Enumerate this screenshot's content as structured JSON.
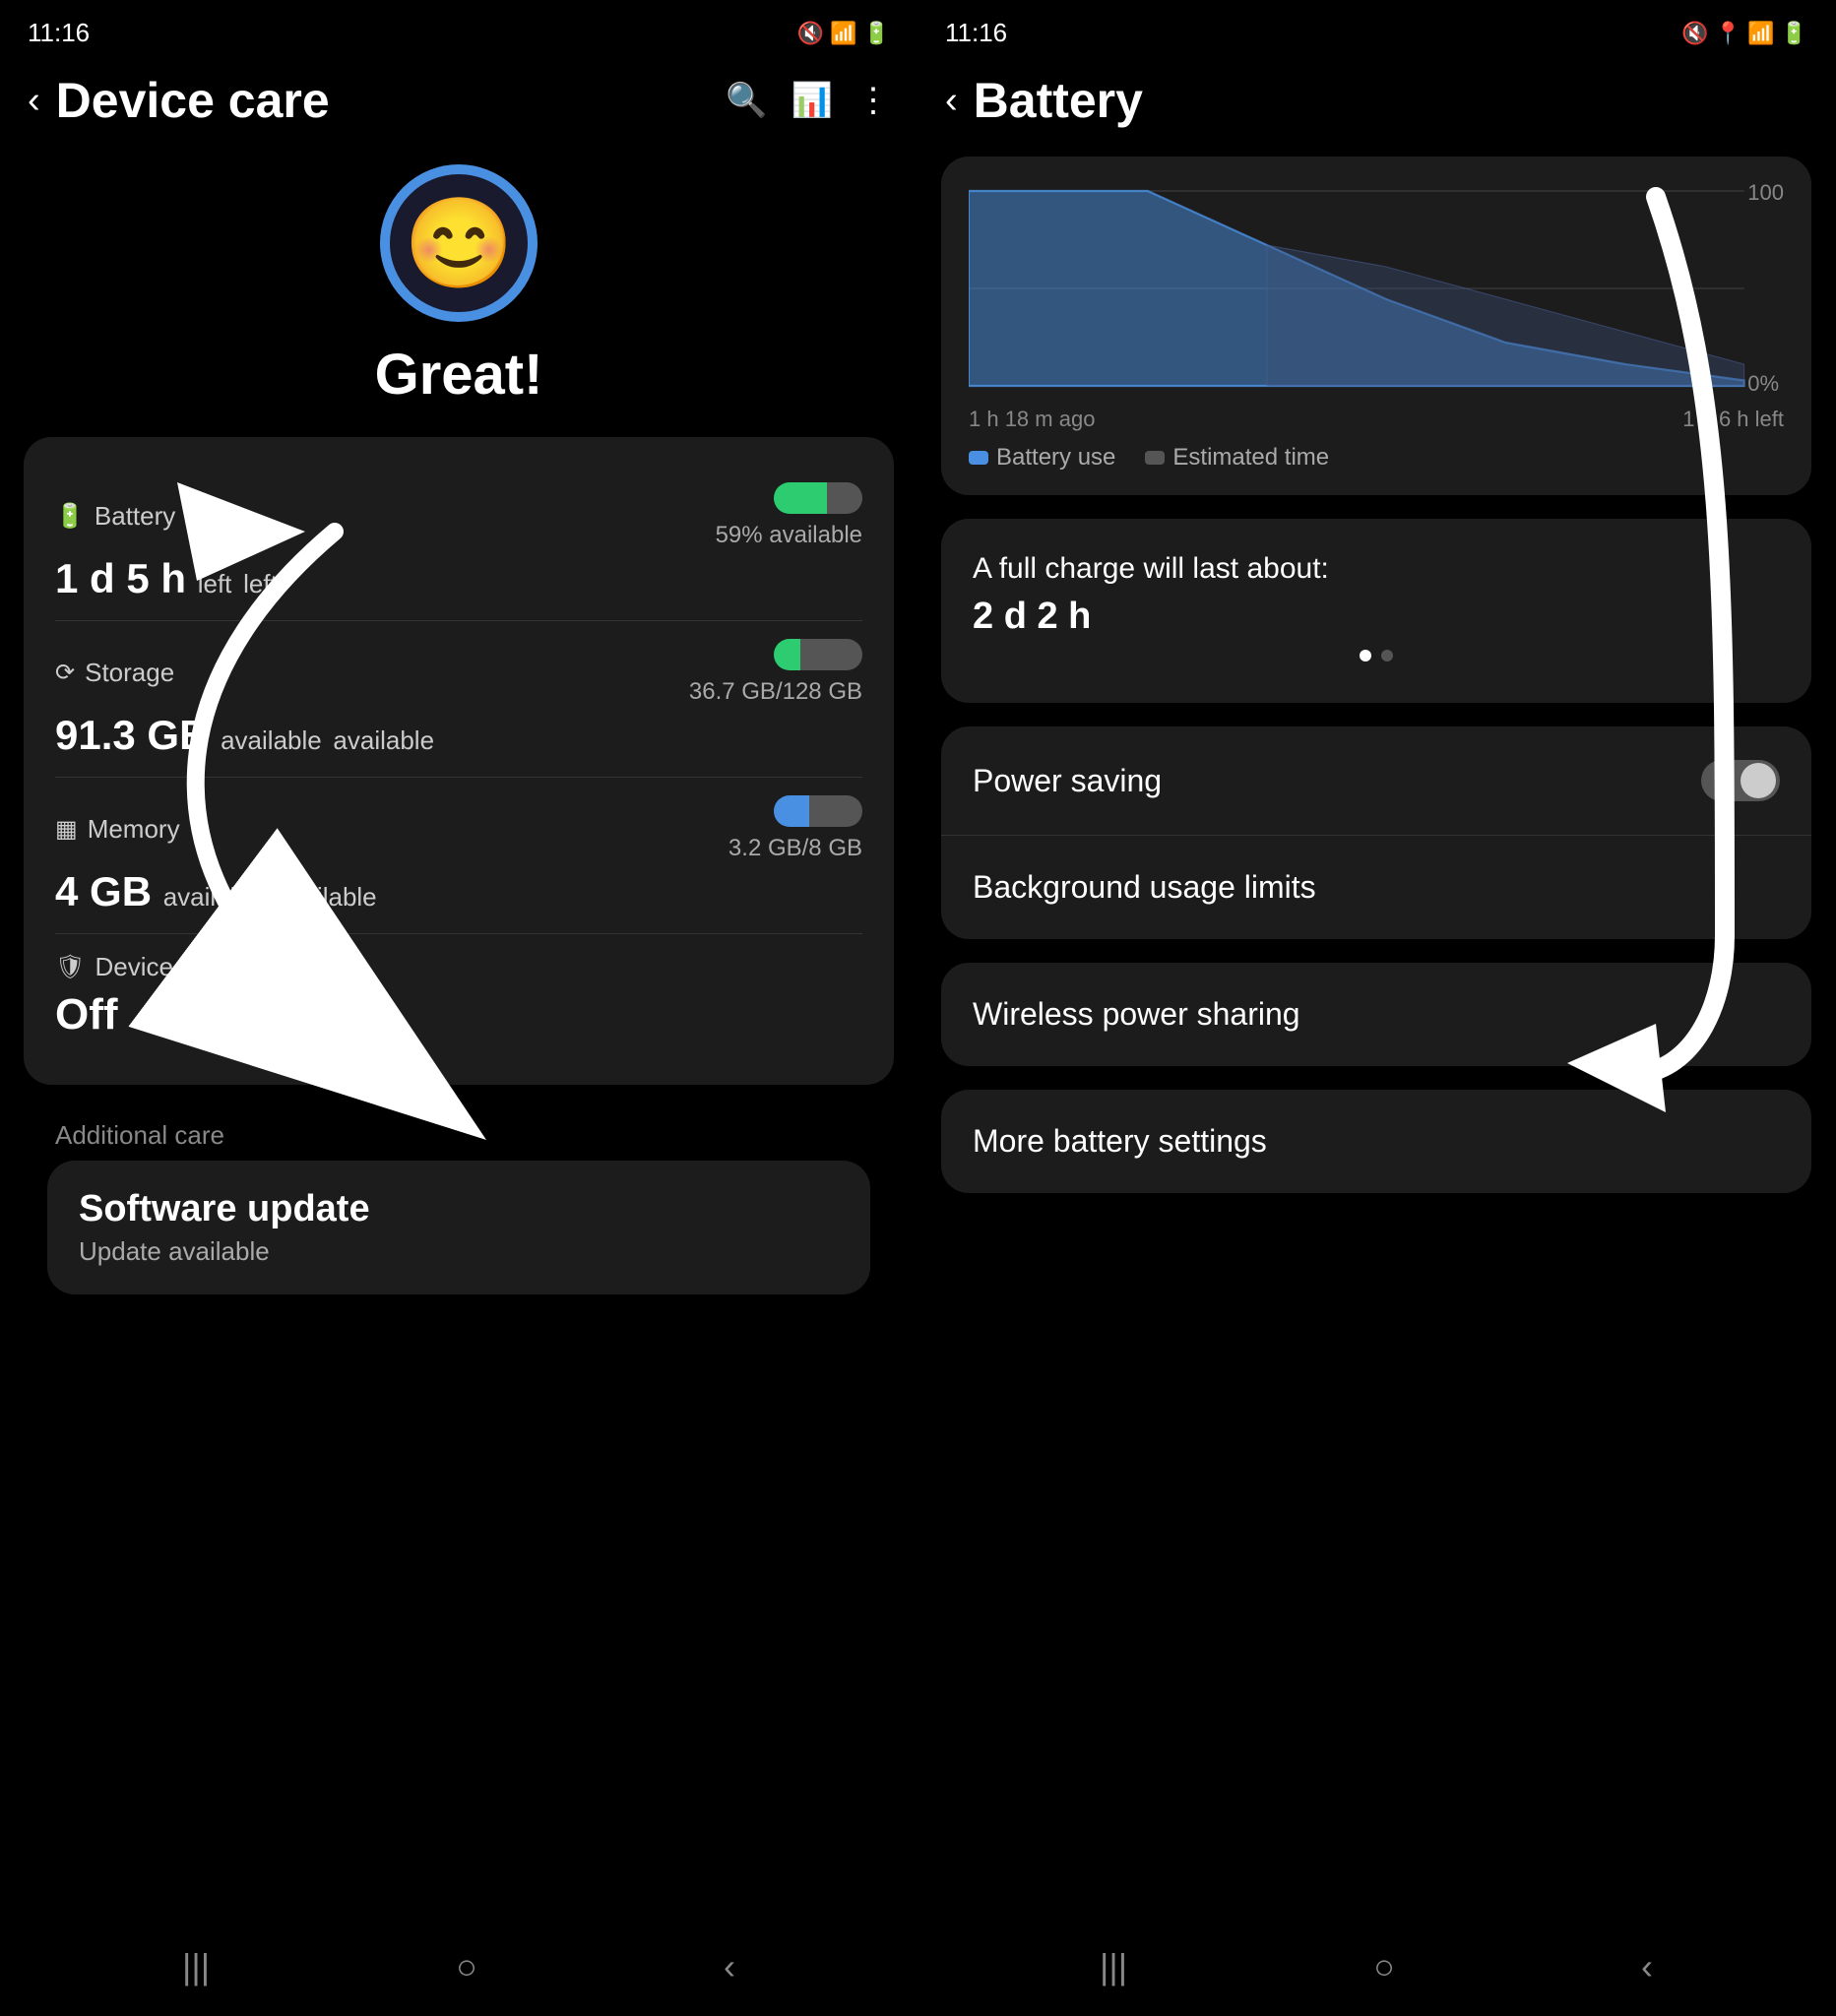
{
  "left": {
    "statusBar": {
      "time": "11:16",
      "rightIcons": "🔇 📶 📶 🔋"
    },
    "topBar": {
      "backLabel": "‹",
      "title": "Device care",
      "searchIcon": "🔍",
      "chartIcon": "📊",
      "moreIcon": "⋮"
    },
    "hero": {
      "statusText": "Great!"
    },
    "battery": {
      "sectionTitle": "Battery",
      "icon": "🔋",
      "value": "1 d 5 h",
      "suffix": "left",
      "available": "59% available"
    },
    "storage": {
      "sectionTitle": "Storage",
      "icon": "⟳",
      "value": "91.3 GB",
      "suffix": "available",
      "used": "36.7 GB",
      "total": "/128 GB"
    },
    "memory": {
      "sectionTitle": "Memory",
      "icon": "▦",
      "value": "4 GB",
      "suffix": "available",
      "used": "3.2 GB",
      "total": "/8 GB"
    },
    "deviceProtection": {
      "sectionTitle": "Device protection",
      "icon": "🛡",
      "value": "Off"
    },
    "additionalCare": {
      "sectionLabel": "Additional care",
      "softwareUpdate": {
        "title": "Software update",
        "subtitle": "Update available"
      }
    },
    "bottomNav": {
      "recents": "|||",
      "home": "○",
      "back": "‹"
    }
  },
  "right": {
    "statusBar": {
      "time": "11:16",
      "rightIcons": "🔇 📍 📶 🔋"
    },
    "topBar": {
      "backLabel": "‹",
      "title": "Battery"
    },
    "chart": {
      "yMax": "100",
      "yMin": "0%",
      "xLeft": "1 h 18 m ago",
      "xRight": "1 d 6 h left",
      "legendBatteryUse": "Battery use",
      "legendEstimatedTime": "Estimated time"
    },
    "fullCharge": {
      "label": "A full charge will last about:",
      "value": "2 d 2 h"
    },
    "powerSaving": {
      "label": "Power saving",
      "toggleState": false
    },
    "backgroundUsageLimits": {
      "label": "Background usage limits"
    },
    "wirelessPowerSharing": {
      "label": "Wireless power sharing"
    },
    "moreBatterySettings": {
      "label": "More battery settings"
    },
    "bottomNav": {
      "recents": "|||",
      "home": "○",
      "back": "‹"
    }
  }
}
